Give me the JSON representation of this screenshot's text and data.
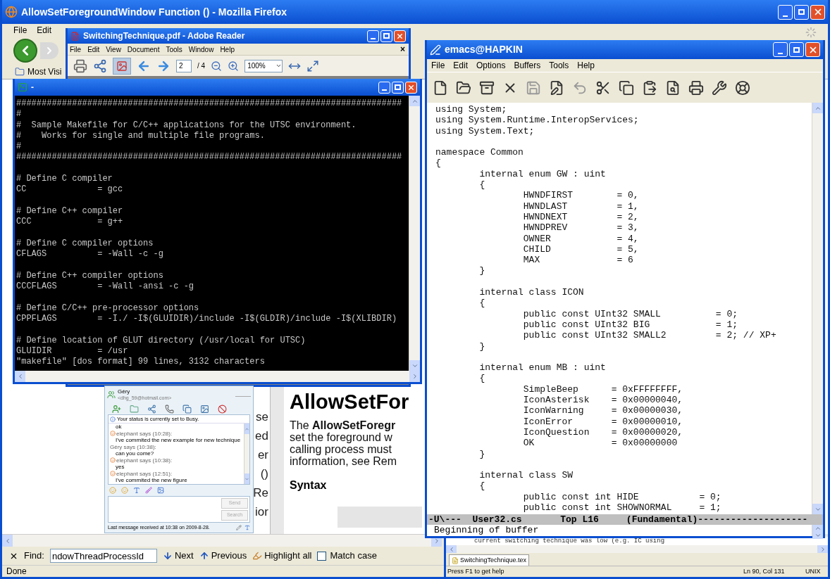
{
  "firefox": {
    "title": "AllowSetForegroundWindow Function () - Mozilla Firefox",
    "menu": [
      "File",
      "Edit"
    ],
    "bookmarks": [
      "Most Visi"
    ],
    "page": {
      "fragments": [
        "se",
        "ed",
        "er",
        "()",
        "Re",
        "ior"
      ],
      "heading": "AllowSetFor",
      "paragraph": [
        "The **AllowSetForegr**",
        "set the foreground w",
        "calling process must",
        "information, see Rem"
      ],
      "section": "Syntax"
    },
    "find_bar": {
      "label": "Find:",
      "value": "ndowThreadProcessId",
      "buttons": [
        "Next",
        "Previous",
        "Highlight all"
      ],
      "match_case": {
        "label": "Match case",
        "checked": false
      }
    },
    "status": "Done"
  },
  "reader": {
    "title": "SwitchingTechnique.pdf - Adobe Reader",
    "menu": [
      "File",
      "Edit",
      "View",
      "Document",
      "Tools",
      "Window",
      "Help"
    ],
    "close_mark": "×",
    "page_number": "2",
    "page_count": "/ 4",
    "zoom": "100%"
  },
  "terminal": {
    "title": "-",
    "blocks": [
      [
        "############################################################################",
        "#",
        "#  Sample Makefile for C/C++ applications for the UTSC environment.",
        "#    Works for single and multiple file programs.",
        "#",
        "############################################################################"
      ],
      [
        "# Define C compiler",
        "CC              = gcc"
      ],
      [
        "# Define C++ compiler",
        "CCC             = g++"
      ],
      [
        "# Define C compiler options",
        "CFLAGS          = -Wall -c -g"
      ],
      [
        "# Define C++ compiler options",
        "CCCFLAGS        = -Wall -ansi -c -g"
      ],
      [
        "# Define C/C++ pre-processor options",
        "CPPFLAGS        = -I./ -I$(GLUIDIR)/include -I$(GLDIR)/include -I$(XLIBDIR)"
      ],
      [
        "# Define location of GLUT directory (/usr/local for UTSC)",
        "GLUIDIR         = /usr"
      ]
    ],
    "status": "\"makefile\" [dos format] 99 lines, 3132 characters"
  },
  "chat": {
    "name": "Géry",
    "email": "<dhg_59@hotmail.com>",
    "notice": "Your status is currently set to Busy.",
    "messages": [
      {
        "kind": "text",
        "text": "ok"
      },
      {
        "kind": "sender",
        "text": "elephant says (10:28):",
        "emoticon": true
      },
      {
        "kind": "text",
        "text": "I've commited the new example for new technique"
      },
      {
        "kind": "sender",
        "text": "Géry says (10:38):",
        "emoticon": false
      },
      {
        "kind": "text",
        "text": "can you come?"
      },
      {
        "kind": "sender",
        "text": "elephant says (10:38):",
        "emoticon": true
      },
      {
        "kind": "text",
        "text": "yes"
      },
      {
        "kind": "sender",
        "text": "elephant says (12:51):",
        "emoticon": true
      },
      {
        "kind": "text",
        "text": "I've commited the new figure"
      }
    ],
    "buttons": [
      {
        "label": "Send",
        "disabled": true
      },
      {
        "label": "Search",
        "disabled": true
      }
    ],
    "footer": "Last message received at 10:38 on 2009-8-28."
  },
  "emacs": {
    "title": "emacs@HAPKIN",
    "menu": [
      "File",
      "Edit",
      "Options",
      "Buffers",
      "Tools",
      "Help"
    ],
    "blocks": [
      [
        "using System;",
        "using System.Runtime.InteropServices;",
        "using System.Text;"
      ],
      [
        "namespace Common",
        "{",
        "        internal enum GW : uint",
        "        {",
        "                HWNDFIRST        = 0,",
        "                HWNDLAST         = 1,",
        "                HWNDNEXT         = 2,",
        "                HWNDPREV         = 3,",
        "                OWNER            = 4,",
        "                CHILD            = 5,",
        "                MAX              = 6",
        "        }"
      ],
      [
        "        internal class ICON",
        "        {",
        "                public const UInt32 SMALL          = 0;",
        "                public const UInt32 BIG            = 1;",
        "                public const UInt32 SMALL2         = 2; // XP+",
        "        }"
      ],
      [
        "        internal enum MB : uint",
        "        {",
        "                SimpleBeep      = 0xFFFFFFFF,",
        "                IconAsterisk    = 0x00000040,",
        "                IconWarning     = 0x00000030,",
        "                IconError       = 0x00000010,",
        "                IconQuestion    = 0x00000020,",
        "                OK              = 0x00000000",
        "        }"
      ],
      [
        "        internal class SW",
        "        {",
        "                public const int HIDE           = 0;",
        "                public const int SHOWNORMAL     = 1;"
      ]
    ],
    "mode_line": "-U\\---  User32.cs       Top L16     (Fundamental)--------------------",
    "minibuffer": "Beginning of buffer"
  },
  "editor": {
    "text_line": "current switching technique was low (e.g. IC using",
    "tab": "SwitchingTechnique.tex",
    "status": "Press F1 to get help",
    "position": "Ln 90, Col 131",
    "line_ending": "UNIX"
  }
}
